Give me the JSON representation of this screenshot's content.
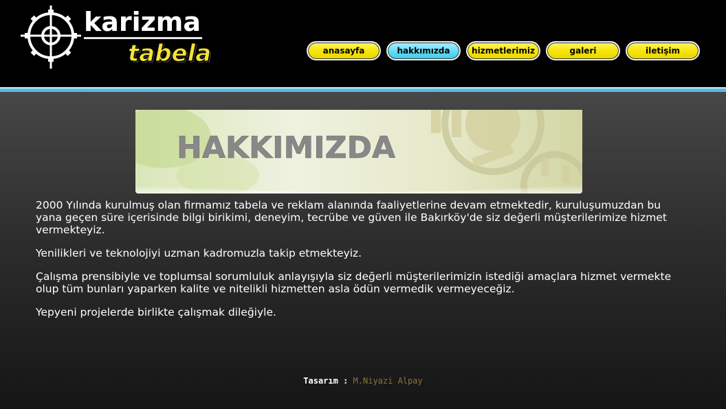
{
  "logo": {
    "line1": "karizma",
    "line2": "tabela"
  },
  "nav": {
    "items": [
      {
        "label": "anasayfa",
        "active": false
      },
      {
        "label": "hakkımızda",
        "active": true
      },
      {
        "label": "hizmetlerimiz",
        "active": false
      },
      {
        "label": "galeri",
        "active": false
      },
      {
        "label": "iletişim",
        "active": false
      }
    ]
  },
  "banner": {
    "title": "HAKKIMIZDA"
  },
  "content": {
    "paragraphs": [
      "2000 Yılında kurulmuş olan firmamız tabela ve reklam alanında faaliyetlerine devam etmektedir, kuruluşumuzdan bu  yana geçen süre içerisinde bilgi birikimi, deneyim, tecrübe ve güven ile Bakırköy'de siz değerli müşterilerimize hizmet vermekteyiz.",
      "Yenilikleri ve teknolojiyi uzman kadromuzla takip etmekteyiz.",
      "Çalışma prensibiyle ve toplumsal sorumluluk anlayışıyla siz değerli müşterilerimizin istediği amaçlara hizmet vermekte olup tüm bunları yaparken kalite ve nitelikli hizmetten asla ödün vermedik vermeyeceğiz.",
      "Yepyeni  projelerde birlikte çalışmak dileğiyle."
    ]
  },
  "footer": {
    "label": "Tasarım :",
    "designer": "M.Niyazi Alpay"
  },
  "colors": {
    "nav_yellow": "#f5e400",
    "nav_active_blue": "#5fdcf6",
    "accent_stripe": "#57b9e0",
    "footer_name": "#8a7438"
  }
}
